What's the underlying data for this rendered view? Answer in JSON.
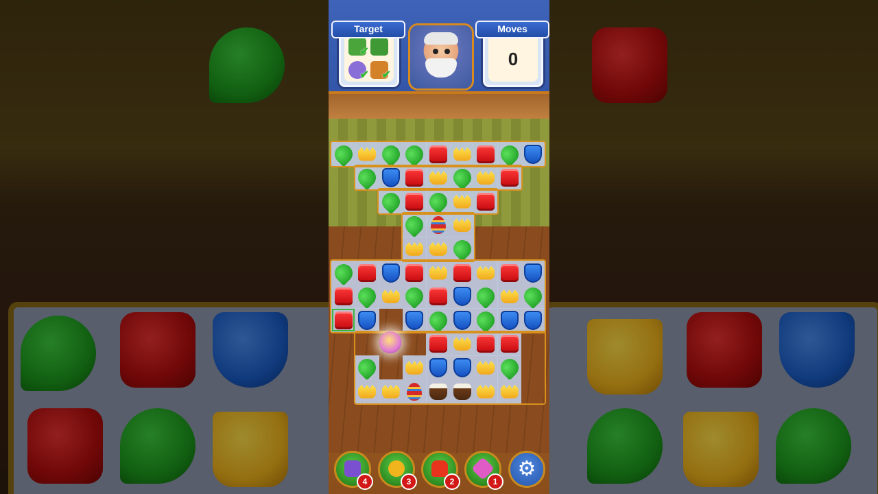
{
  "header": {
    "target_label": "Target",
    "moves_label": "Moves",
    "moves_value": "0"
  },
  "targets": [
    {
      "name": "grass-tile",
      "done": true,
      "color": "#4aa53a"
    },
    {
      "name": "grass-tile-alt",
      "done": false,
      "color": "#3f9a35"
    },
    {
      "name": "striped-egg",
      "done": true,
      "color": "#8a6ed8"
    },
    {
      "name": "wooden-box",
      "done": true,
      "color": "#d4822a"
    }
  ],
  "check_glyph": "✔",
  "boosters": [
    {
      "name": "hammer",
      "count": "4",
      "color": "#7a4fd0"
    },
    {
      "name": "bomb-egg",
      "count": "3",
      "color": "#f0b41c"
    },
    {
      "name": "fire-hydrant",
      "count": "2",
      "color": "#e8341c"
    },
    {
      "name": "gem-swap",
      "count": "1",
      "color": "#e05bc6"
    }
  ],
  "settings_glyph": "⚙",
  "board": {
    "rows": [
      [
        "green",
        "yellow",
        "green",
        "green",
        "red",
        "yellow",
        "red",
        "green",
        "blue"
      ],
      [
        "",
        "green",
        "blue",
        "red",
        "yellow",
        "green",
        "yellow",
        "red",
        ""
      ],
      [
        "",
        "",
        "green",
        "red",
        "green",
        "yellow",
        "red",
        "",
        ""
      ],
      [
        "",
        "",
        "",
        "green",
        "egg",
        "yellow",
        "",
        "",
        ""
      ],
      [
        "",
        "",
        "",
        "yellow",
        "yellow",
        "green",
        "",
        "",
        ""
      ],
      [
        "green",
        "red",
        "blue",
        "red",
        "yellow",
        "red",
        "yellow",
        "red",
        "blue"
      ],
      [
        "red",
        "green",
        "yellow",
        "green",
        "red",
        "blue",
        "green",
        "yellow",
        "green"
      ],
      [
        "red",
        "blue",
        "",
        "blue",
        "green",
        "blue",
        "green",
        "blue",
        "blue"
      ],
      [
        "",
        "",
        "",
        "",
        "red",
        "yellow",
        "red",
        "red",
        ""
      ],
      [
        "",
        "green",
        "",
        "yellow",
        "blue",
        "blue",
        "yellow",
        "green",
        ""
      ],
      [
        "",
        "yellow",
        "yellow",
        "egg",
        "pot",
        "pot",
        "yellow",
        "yellow",
        ""
      ]
    ]
  }
}
